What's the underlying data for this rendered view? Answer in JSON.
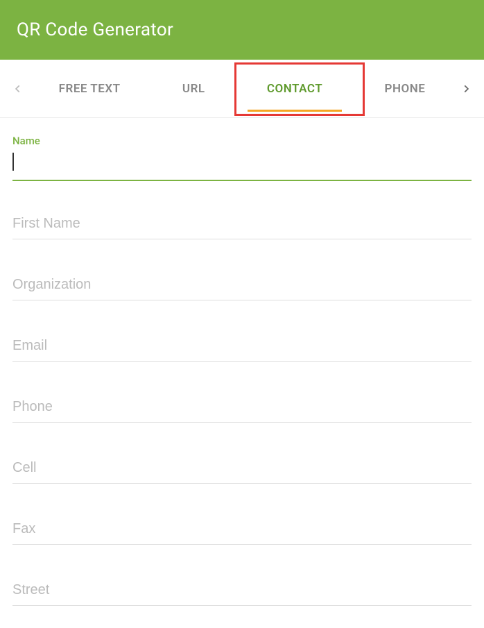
{
  "header": {
    "title": "QR Code Generator"
  },
  "tabs": {
    "items": [
      {
        "label": "FREE TEXT",
        "active": false
      },
      {
        "label": "URL",
        "active": false
      },
      {
        "label": "CONTACT",
        "active": true
      },
      {
        "label": "PHONE",
        "active": false
      }
    ]
  },
  "form": {
    "name_label": "Name",
    "name_value": "",
    "fields": {
      "first_name": {
        "placeholder": "First Name",
        "value": ""
      },
      "organization": {
        "placeholder": "Organization",
        "value": ""
      },
      "email": {
        "placeholder": "Email",
        "value": ""
      },
      "phone": {
        "placeholder": "Phone",
        "value": ""
      },
      "cell": {
        "placeholder": "Cell",
        "value": ""
      },
      "fax": {
        "placeholder": "Fax",
        "value": ""
      },
      "street": {
        "placeholder": "Street",
        "value": ""
      }
    }
  }
}
